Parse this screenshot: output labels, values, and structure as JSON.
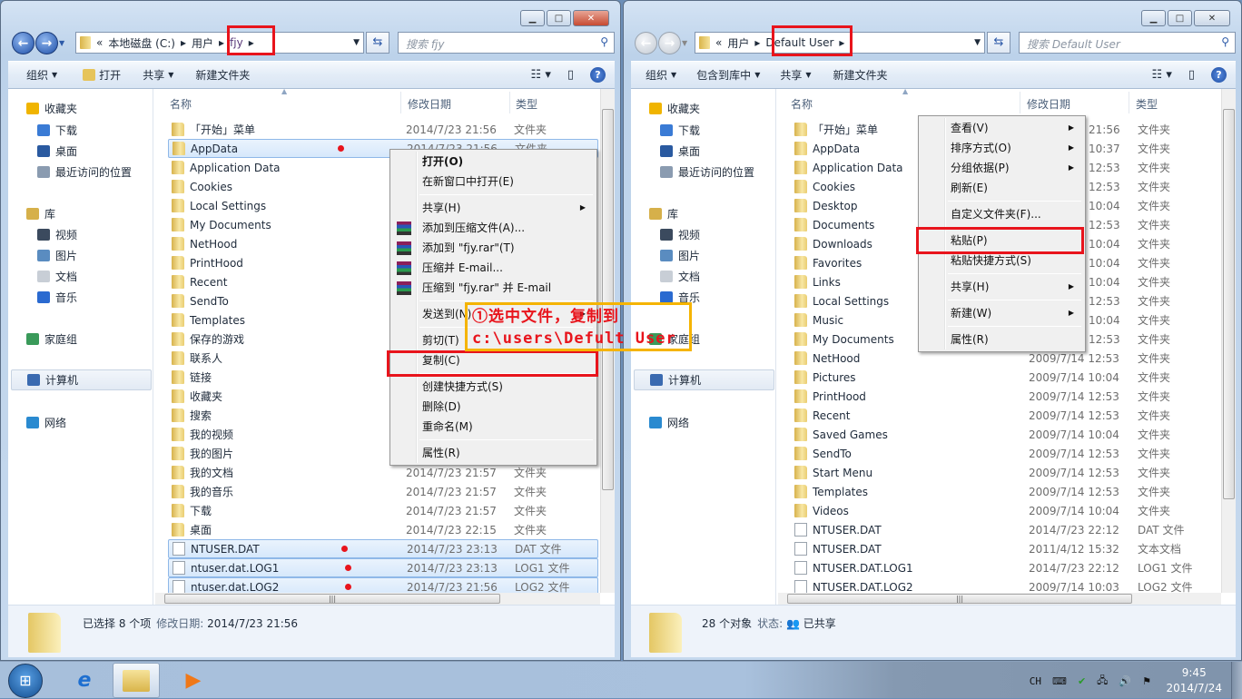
{
  "left": {
    "address": {
      "prefix": "«",
      "crumbs": [
        "本地磁盘 (C:)",
        "用户",
        "fjy"
      ]
    },
    "search_placeholder": "搜索 fjy",
    "toolbar": [
      "组织",
      "打开",
      "共享",
      "新建文件夹"
    ],
    "columns": {
      "name": "名称",
      "date": "修改日期",
      "type": "类型"
    },
    "rows": [
      {
        "name": "「开始」菜单",
        "date": "2014/7/23 21:56",
        "type": "文件夹",
        "icon": "folder"
      },
      {
        "name": "AppData",
        "date": "2014/7/23 21:56",
        "type": "文件夹",
        "icon": "folder",
        "selected": true,
        "dot": true
      },
      {
        "name": "Application Data",
        "date": "",
        "type": "",
        "icon": "folder"
      },
      {
        "name": "Cookies",
        "date": "",
        "type": "",
        "icon": "folder"
      },
      {
        "name": "Local Settings",
        "date": "",
        "type": "",
        "icon": "folder"
      },
      {
        "name": "My Documents",
        "date": "",
        "type": "",
        "icon": "folder"
      },
      {
        "name": "NetHood",
        "date": "",
        "type": "",
        "icon": "folder"
      },
      {
        "name": "PrintHood",
        "date": "",
        "type": "",
        "icon": "folder"
      },
      {
        "name": "Recent",
        "date": "",
        "type": "",
        "icon": "folder"
      },
      {
        "name": "SendTo",
        "date": "",
        "type": "",
        "icon": "folder"
      },
      {
        "name": "Templates",
        "date": "",
        "type": "",
        "icon": "folder"
      },
      {
        "name": "保存的游戏",
        "date": "",
        "type": "",
        "icon": "folder"
      },
      {
        "name": "联系人",
        "date": "",
        "type": "",
        "icon": "folder"
      },
      {
        "name": "链接",
        "date": "",
        "type": "",
        "icon": "folder"
      },
      {
        "name": "收藏夹",
        "date": "",
        "type": "",
        "icon": "folder"
      },
      {
        "name": "搜索",
        "date": "",
        "type": "",
        "icon": "folder"
      },
      {
        "name": "我的视频",
        "date": "",
        "type": "",
        "icon": "folder"
      },
      {
        "name": "我的图片",
        "date": "",
        "type": "",
        "icon": "folder"
      },
      {
        "name": "我的文档",
        "date": "2014/7/23 21:57",
        "type": "文件夹",
        "icon": "folder"
      },
      {
        "name": "我的音乐",
        "date": "2014/7/23 21:57",
        "type": "文件夹",
        "icon": "folder"
      },
      {
        "name": "下载",
        "date": "2014/7/23 21:57",
        "type": "文件夹",
        "icon": "folder"
      },
      {
        "name": "桌面",
        "date": "2014/7/23 22:15",
        "type": "文件夹",
        "icon": "folder"
      },
      {
        "name": "NTUSER.DAT",
        "date": "2014/7/23 23:13",
        "type": "DAT 文件",
        "icon": "file",
        "selected": true,
        "dot": true
      },
      {
        "name": "ntuser.dat.LOG1",
        "date": "2014/7/23 23:13",
        "type": "LOG1 文件",
        "icon": "file",
        "selected": true,
        "dot": true
      },
      {
        "name": "ntuser.dat.LOG2",
        "date": "2014/7/23 21:56",
        "type": "LOG2 文件",
        "icon": "file",
        "selected": true,
        "dot": true
      }
    ],
    "status": {
      "text": "已选择 8 个项",
      "label": "修改日期:",
      "value": "2014/7/23 21:56"
    },
    "context_menu": [
      {
        "label": "打开(O)",
        "bold": true
      },
      {
        "label": "在新窗口中打开(E)"
      },
      {
        "sep": true
      },
      {
        "label": "共享(H)",
        "sub": true
      },
      {
        "label": "添加到压缩文件(A)...",
        "rar": true
      },
      {
        "label": "添加到 \"fjy.rar\"(T)",
        "rar": true
      },
      {
        "label": "压缩并 E-mail...",
        "rar": true
      },
      {
        "label": "压缩到 \"fjy.rar\" 并 E-mail",
        "rar": true
      },
      {
        "sep": true
      },
      {
        "label": "发送到(N)",
        "sub": true
      },
      {
        "sep": true
      },
      {
        "label": "剪切(T)"
      },
      {
        "label": "复制(C)",
        "highlighted": true
      },
      {
        "sep": true
      },
      {
        "label": "创建快捷方式(S)"
      },
      {
        "label": "删除(D)"
      },
      {
        "label": "重命名(M)"
      },
      {
        "sep": true
      },
      {
        "label": "属性(R)"
      }
    ]
  },
  "right": {
    "address": {
      "prefix": "«",
      "crumbs": [
        "用户",
        "Default User"
      ]
    },
    "search_placeholder": "搜索 Default User",
    "toolbar": [
      "组织",
      "包含到库中",
      "共享",
      "新建文件夹"
    ],
    "columns": {
      "name": "名称",
      "date": "修改日期",
      "type": "类型"
    },
    "rows": [
      {
        "name": "「开始」菜单",
        "date": "21:56",
        "type": "文件夹",
        "icon": "folder",
        "partial": true
      },
      {
        "name": "AppData",
        "date": "10:37",
        "type": "文件夹",
        "icon": "folder",
        "partial": true
      },
      {
        "name": "Application Data",
        "date": "12:53",
        "type": "文件夹",
        "icon": "folder",
        "partial": true
      },
      {
        "name": "Cookies",
        "date": "12:53",
        "type": "文件夹",
        "icon": "folder",
        "partial": true
      },
      {
        "name": "Desktop",
        "date": "10:04",
        "type": "文件夹",
        "icon": "folder",
        "partial": true
      },
      {
        "name": "Documents",
        "date": "12:53",
        "type": "文件夹",
        "icon": "folder",
        "partial": true
      },
      {
        "name": "Downloads",
        "date": "10:04",
        "type": "文件夹",
        "icon": "folder",
        "partial": true
      },
      {
        "name": "Favorites",
        "date": "10:04",
        "type": "文件夹",
        "icon": "folder",
        "partial": true
      },
      {
        "name": "Links",
        "date": "10:04",
        "type": "文件夹",
        "icon": "folder",
        "partial": true
      },
      {
        "name": "Local Settings",
        "date": "12:53",
        "type": "文件夹",
        "icon": "folder",
        "partial": true
      },
      {
        "name": "Music",
        "date": "10:04",
        "type": "文件夹",
        "icon": "folder",
        "partial": true
      },
      {
        "name": "My Documents",
        "date": "12:53",
        "type": "文件夹",
        "icon": "folder",
        "partial": true
      },
      {
        "name": "NetHood",
        "date": "2009/7/14 12:53",
        "type": "文件夹",
        "icon": "folder"
      },
      {
        "name": "Pictures",
        "date": "2009/7/14 10:04",
        "type": "文件夹",
        "icon": "folder"
      },
      {
        "name": "PrintHood",
        "date": "2009/7/14 12:53",
        "type": "文件夹",
        "icon": "folder"
      },
      {
        "name": "Recent",
        "date": "2009/7/14 12:53",
        "type": "文件夹",
        "icon": "folder"
      },
      {
        "name": "Saved Games",
        "date": "2009/7/14 10:04",
        "type": "文件夹",
        "icon": "folder"
      },
      {
        "name": "SendTo",
        "date": "2009/7/14 12:53",
        "type": "文件夹",
        "icon": "folder"
      },
      {
        "name": "Start Menu",
        "date": "2009/7/14 12:53",
        "type": "文件夹",
        "icon": "folder"
      },
      {
        "name": "Templates",
        "date": "2009/7/14 12:53",
        "type": "文件夹",
        "icon": "folder"
      },
      {
        "name": "Videos",
        "date": "2009/7/14 10:04",
        "type": "文件夹",
        "icon": "folder"
      },
      {
        "name": "NTUSER.DAT",
        "date": "2014/7/23 22:12",
        "type": "DAT 文件",
        "icon": "file"
      },
      {
        "name": "NTUSER.DAT",
        "date": "2011/4/12 15:32",
        "type": "文本文档",
        "icon": "file"
      },
      {
        "name": "NTUSER.DAT.LOG1",
        "date": "2014/7/23 22:12",
        "type": "LOG1 文件",
        "icon": "file"
      },
      {
        "name": "NTUSER.DAT.LOG2",
        "date": "2009/7/14 10:03",
        "type": "LOG2 文件",
        "icon": "file"
      }
    ],
    "status": {
      "text": "28 个对象",
      "label": "状态:",
      "value": "已共享"
    },
    "context_menu": [
      {
        "label": "查看(V)",
        "sub": true
      },
      {
        "label": "排序方式(O)",
        "sub": true
      },
      {
        "label": "分组依据(P)",
        "sub": true
      },
      {
        "label": "刷新(E)"
      },
      {
        "sep": true
      },
      {
        "label": "自定义文件夹(F)..."
      },
      {
        "sep": true
      },
      {
        "label": "粘贴(P)",
        "highlighted": true
      },
      {
        "label": "粘贴快捷方式(S)"
      },
      {
        "sep": true
      },
      {
        "label": "共享(H)",
        "sub": true
      },
      {
        "sep": true
      },
      {
        "label": "新建(W)",
        "sub": true
      },
      {
        "sep": true
      },
      {
        "label": "属性(R)"
      }
    ]
  },
  "nav_pane": [
    {
      "label": "收藏夹",
      "icon": "star-icon",
      "color": "#f0b400"
    },
    {
      "label": "下载",
      "icon": "download-folder-icon",
      "color": "#3a7bd5",
      "sub": true
    },
    {
      "label": "桌面",
      "icon": "desktop-icon",
      "color": "#2a5aa0",
      "sub": true
    },
    {
      "label": "最近访问的位置",
      "icon": "recent-places-icon",
      "color": "#8a9bb0",
      "sub": true
    },
    {
      "label": "库",
      "icon": "library-icon",
      "color": "#d6b04a"
    },
    {
      "label": "视频",
      "icon": "video-icon",
      "color": "#3b4a5e",
      "sub": true
    },
    {
      "label": "图片",
      "icon": "picture-icon",
      "color": "#5a8cc0",
      "sub": true
    },
    {
      "label": "文档",
      "icon": "document-icon",
      "color": "#c8ced6",
      "sub": true
    },
    {
      "label": "音乐",
      "icon": "music-icon",
      "color": "#2a6ad0",
      "sub": true
    },
    {
      "label": "家庭组",
      "icon": "homegroup-icon",
      "color": "#3a9a5a"
    },
    {
      "label": "计算机",
      "icon": "computer-icon",
      "color": "#3a6ab0",
      "highlighted": true
    },
    {
      "label": "网络",
      "icon": "network-icon",
      "color": "#2a8ad0"
    }
  ],
  "annotation": {
    "line1": "①选中文件，复制到",
    "line2": "c:\\users\\Defult User",
    "border_color": "#f5b400",
    "text_color": "#e8141c"
  },
  "taskbar": {
    "ime": "CH",
    "time": "9:45",
    "date": "2014/7/24"
  },
  "colors": {
    "highlight_box": "#e8141c",
    "selection": "#d6e8fb"
  }
}
